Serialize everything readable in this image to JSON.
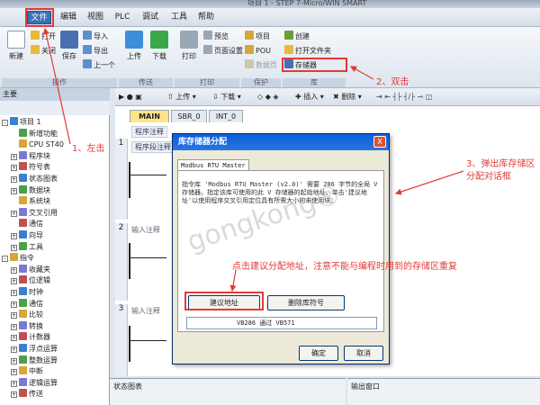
{
  "window_title": "项目 1 - STEP 7-Micro/WIN SMART",
  "menu": [
    "文件",
    "编辑",
    "视图",
    "PLC",
    "调试",
    "工具",
    "帮助"
  ],
  "ribbon": {
    "file_group": {
      "new": "新建",
      "open": "打开",
      "close": "关闭",
      "save": "保存",
      "import": "导入",
      "export": "导出",
      "previous": "上一个",
      "label": "操作"
    },
    "transfer_group": {
      "upload": "上传",
      "download": "下载",
      "label": "传送"
    },
    "print_group": {
      "print": "打印",
      "preview": "预览",
      "page_setup": "页面设置",
      "label": "打印"
    },
    "protect_group": {
      "project": "项目",
      "pou": "POU",
      "data_page": "数据页",
      "label": "保护"
    },
    "library_group": {
      "create": "创建",
      "open_folder": "打开文件夹",
      "memory": "存储器",
      "label": "库"
    }
  },
  "toolbar": {
    "upload": "上传",
    "download": "下载",
    "insert": "插入",
    "delete": "删除"
  },
  "left_panel": {
    "header": "主要",
    "tree": [
      {
        "label": "项目 1",
        "level": 0,
        "expander": "-"
      },
      {
        "label": "新增功能",
        "level": 1,
        "expander": ""
      },
      {
        "label": "CPU ST40",
        "level": 1,
        "expander": ""
      },
      {
        "label": "程序块",
        "level": 1,
        "expander": "+"
      },
      {
        "label": "符号表",
        "level": 1,
        "expander": "+"
      },
      {
        "label": "状态图表",
        "level": 1,
        "expander": "+"
      },
      {
        "label": "数据块",
        "level": 1,
        "expander": "+"
      },
      {
        "label": "系统块",
        "level": 1,
        "expander": ""
      },
      {
        "label": "交叉引用",
        "level": 1,
        "expander": "+"
      },
      {
        "label": "通信",
        "level": 1,
        "expander": ""
      },
      {
        "label": "向导",
        "level": 1,
        "expander": "+"
      },
      {
        "label": "工具",
        "level": 1,
        "expander": "+"
      },
      {
        "label": "指令",
        "level": 0,
        "expander": "-"
      },
      {
        "label": "收藏夹",
        "level": 1,
        "expander": "+"
      },
      {
        "label": "位逻辑",
        "level": 1,
        "expander": "+"
      },
      {
        "label": "时钟",
        "level": 1,
        "expander": "+"
      },
      {
        "label": "通信",
        "level": 1,
        "expander": "+"
      },
      {
        "label": "比较",
        "level": 1,
        "expander": "+"
      },
      {
        "label": "转换",
        "level": 1,
        "expander": "+"
      },
      {
        "label": "计数器",
        "level": 1,
        "expander": "+"
      },
      {
        "label": "浮点运算",
        "level": 1,
        "expander": "+"
      },
      {
        "label": "整数运算",
        "level": 1,
        "expander": "+"
      },
      {
        "label": "中断",
        "level": 1,
        "expander": "+"
      },
      {
        "label": "逻辑运算",
        "level": 1,
        "expander": "+"
      },
      {
        "label": "传送",
        "level": 1,
        "expander": "+"
      }
    ]
  },
  "editor": {
    "tabs": [
      "MAIN",
      "SBR_0",
      "INT_0"
    ],
    "program_comment": "程序注释",
    "networks": [
      {
        "number": "1",
        "comment": "程序段注释"
      },
      {
        "number": "2",
        "comment": "输入注释"
      },
      {
        "number": "3",
        "comment": "输入注释"
      }
    ]
  },
  "bottom": {
    "status_chart": "状态图表",
    "output_window": "输出窗口"
  },
  "dialog": {
    "title": "库存储器分配",
    "tab": "Modbus RTU Master (v2.0)",
    "description": "指令库 'Modbus RTU Master (v2.0)' 需要 286 字节的全局 V 存储器。指定该库可使用的此 V 存储器的起始地址。单击'建议地址'以使用程序交叉引用定位具有所需大小的未使用块。",
    "suggest_button": "建议地址",
    "delete_button": "删除库符号",
    "address_start": "VB286",
    "address_sep": "通过",
    "address_end": "VB571",
    "ok_button": "确定",
    "cancel_button": "取消",
    "close_glyph": "X"
  },
  "annotations": {
    "a1": "1、左击",
    "a2": "2、双击",
    "a3": "3、弹出库存储区分配对话框",
    "note": "点击建议分配地址，注意不能与编程时用到的存储区重复"
  },
  "watermark": "gongkong®"
}
